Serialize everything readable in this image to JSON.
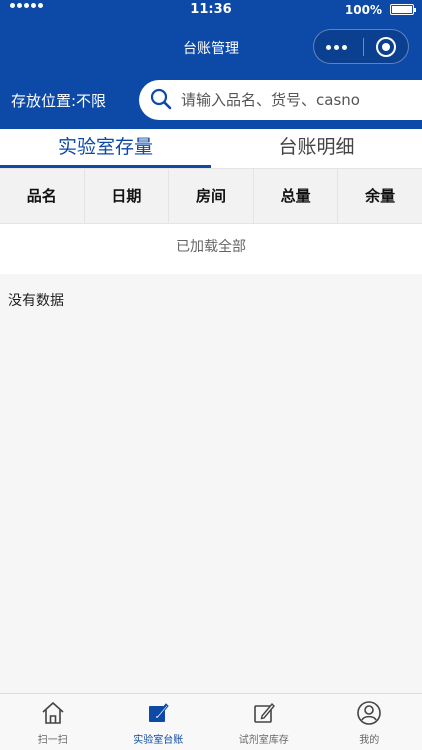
{
  "status_bar": {
    "time": "11:36",
    "battery": "100%"
  },
  "nav": {
    "title": "台账管理"
  },
  "search_bar": {
    "location_label": "存放位置:不限",
    "placeholder": "请输入品名、货号、casno"
  },
  "tabs": [
    {
      "label": "实验室存量",
      "active": true
    },
    {
      "label": "台账明细",
      "active": false
    }
  ],
  "table": {
    "columns": [
      "品名",
      "日期",
      "房间",
      "总量",
      "余量"
    ]
  },
  "list": {
    "loaded_text": "已加载全部",
    "empty_text": "没有数据"
  },
  "tabbar": {
    "items": [
      {
        "label": "扫一扫",
        "icon": "home-icon",
        "active": false
      },
      {
        "label": "实验室台账",
        "icon": "edit-icon",
        "active": true
      },
      {
        "label": "试剂室库存",
        "icon": "edit-outline-icon",
        "active": false
      },
      {
        "label": "我的",
        "icon": "user-icon",
        "active": false
      }
    ]
  },
  "colors": {
    "brand": "#0d49a6",
    "background": "#f6f6f6"
  }
}
